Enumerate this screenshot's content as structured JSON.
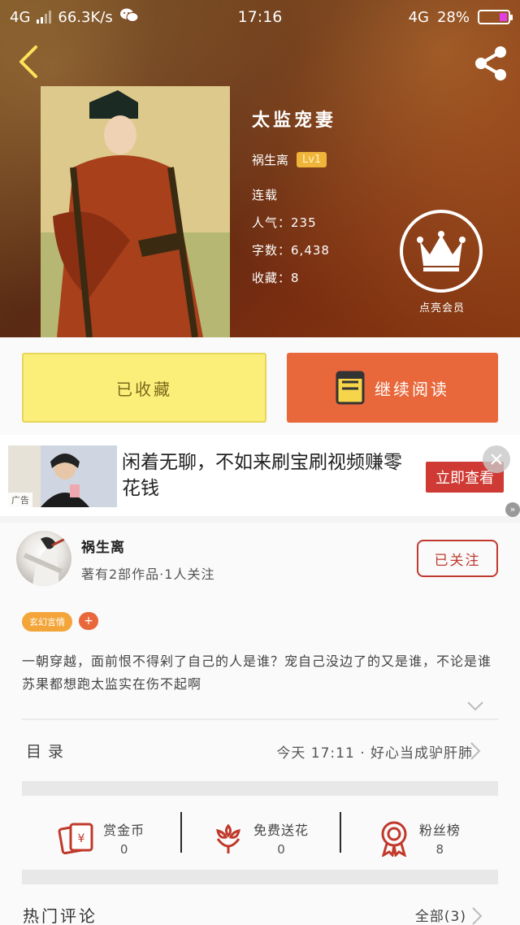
{
  "status_bar": {
    "network_left": "4G",
    "speed": "66.3K/s",
    "time": "17:16",
    "network_right": "4G",
    "battery": "28%"
  },
  "book": {
    "title": "太监宠妻",
    "author": "祸生离",
    "level": "Lv1",
    "status": "连载",
    "popularity_label": "人气：",
    "popularity": "235",
    "words_label": "字数：",
    "words": "6,438",
    "favorites_label": "收藏：",
    "favorites": "8",
    "vip_label": "点亮会员"
  },
  "actions": {
    "collect_label": "已收藏",
    "read_label": "继续阅读"
  },
  "ad": {
    "tag": "广告",
    "text": "闲着无聊，不如来刷宝刷视频赚零花钱",
    "cta": "立即查看"
  },
  "author_card": {
    "name": "祸生离",
    "meta": "著有2部作品·1人关注",
    "follow_label": "已关注"
  },
  "tags": [
    "玄幻言情"
  ],
  "description": "一朝穿越，面前恨不得剁了自己的人是谁？宠自己没边了的又是谁，不论是谁苏果都想跑太监实在伤不起啊",
  "toc": {
    "label": "目录",
    "latest": "今天 17:11 · 好心当成驴肝肺"
  },
  "rewards": [
    {
      "label": "赏金币",
      "count": "0",
      "icon": "coin-envelope-icon"
    },
    {
      "label": "免费送花",
      "count": "0",
      "icon": "flower-icon"
    },
    {
      "label": "粉丝榜",
      "count": "8",
      "icon": "medal-icon"
    }
  ],
  "hot_comments": {
    "title": "热门评论",
    "all_label": "全部(3)"
  },
  "colors": {
    "accent_orange": "#e8673b",
    "collect_yellow": "#fbee79",
    "follow_red": "#c03a2f",
    "tag_orange": "#f3a53a"
  }
}
